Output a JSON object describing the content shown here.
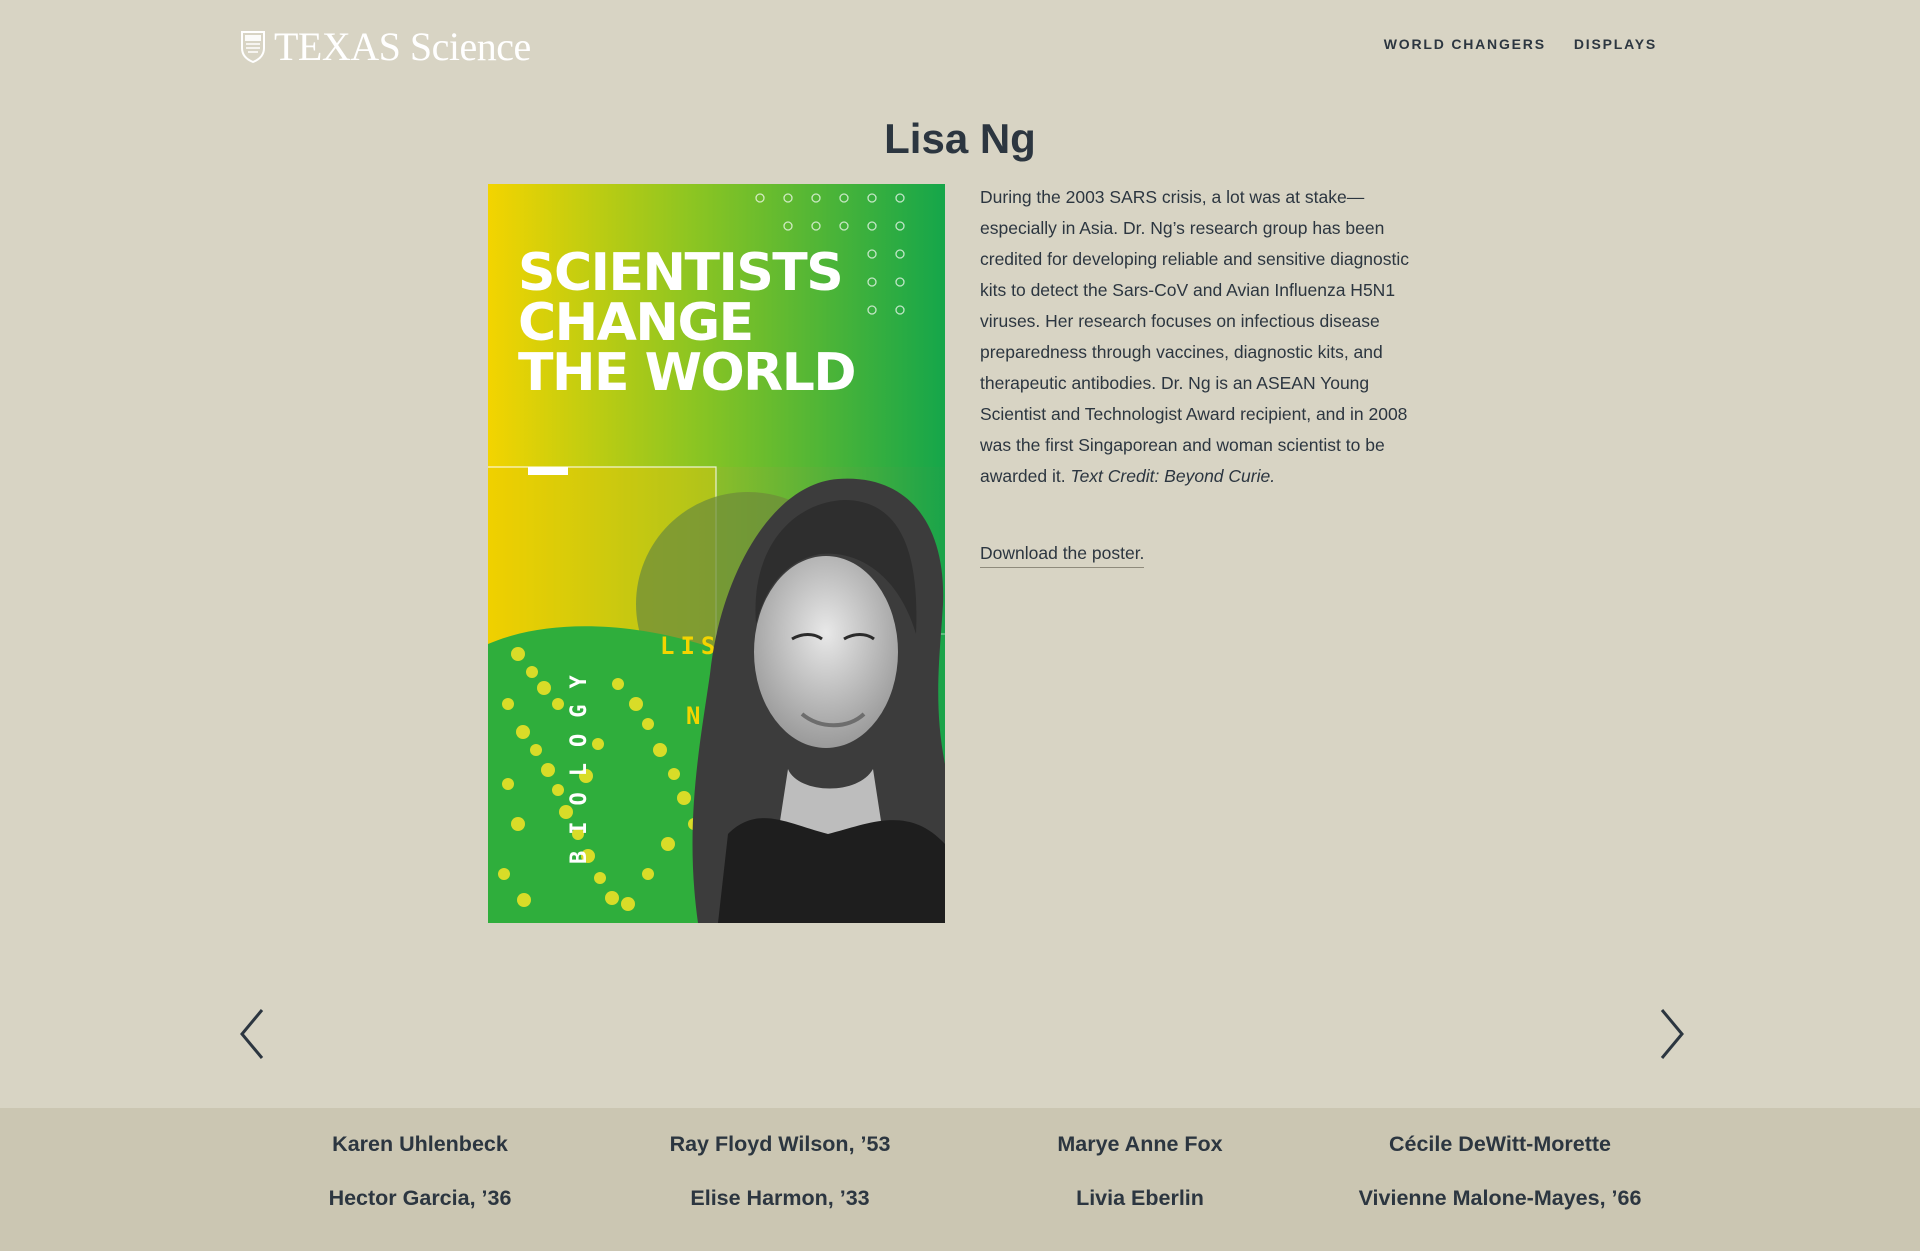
{
  "header": {
    "logo_text": "TEXAS Science",
    "logo_icon": "ut-shield-icon",
    "nav": [
      {
        "label": "WORLD CHANGERS"
      },
      {
        "label": "DISPLAYS"
      }
    ]
  },
  "main": {
    "title": "Lisa Ng",
    "poster": {
      "headline_lines": [
        "SCIENTISTS",
        "CHANGE",
        "THE WORLD"
      ],
      "first_name": "LISA",
      "last_name": "NG",
      "field": "BIOLOGY"
    },
    "description_main": "During the 2003 SARS crisis, a lot was at stake—especially in Asia. Dr. Ng’s research group has been credited for developing reliable and sensitive diagnostic kits to detect the Sars-CoV and Avian Influenza H5N1 viruses. Her research focuses on infectious disease preparedness through vaccines, diagnostic kits, and therapeutic antibodies. Dr. Ng is an ASEAN Young Scientist and Technologist Award recipient, and in 2008 was the first Singaporean and woman scientist to be awarded it.",
    "description_credit": "Text Credit: Beyond Curie.",
    "download_label": "Download the poster."
  },
  "carousel": {
    "prev_icon": "chevron-left-icon",
    "next_icon": "chevron-right-icon"
  },
  "scientists": [
    {
      "name": "Karen Uhlenbeck"
    },
    {
      "name": "Ray Floyd Wilson, ’53"
    },
    {
      "name": "Marye Anne Fox"
    },
    {
      "name": "Cécile DeWitt-Morette"
    },
    {
      "name": "Hector Garcia, ’36"
    },
    {
      "name": "Elise Harmon, ’33"
    },
    {
      "name": "Livia Eberlin"
    },
    {
      "name": "Vivienne Malone-Mayes, ’66"
    }
  ],
  "colors": {
    "page_background": "#d8d4c4",
    "footer_background": "#cbc6b2",
    "text": "#2c3640",
    "poster_yellow": "#f3d400",
    "poster_green": "#18a84a"
  }
}
